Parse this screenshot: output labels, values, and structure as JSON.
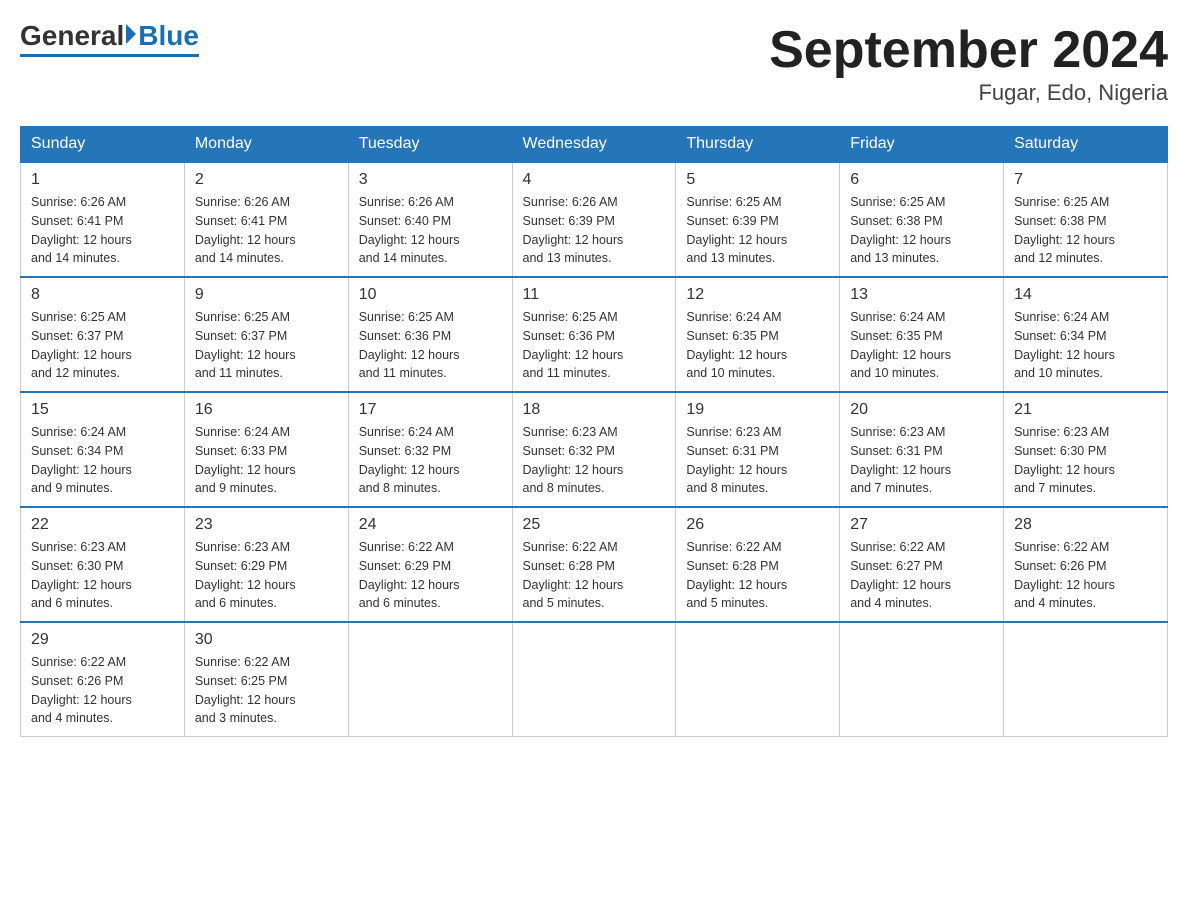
{
  "header": {
    "logo_general": "General",
    "logo_blue": "Blue",
    "month_title": "September 2024",
    "location": "Fugar, Edo, Nigeria"
  },
  "days_of_week": [
    "Sunday",
    "Monday",
    "Tuesday",
    "Wednesday",
    "Thursday",
    "Friday",
    "Saturday"
  ],
  "weeks": [
    [
      {
        "day": "1",
        "sunrise": "6:26 AM",
        "sunset": "6:41 PM",
        "daylight": "12 hours and 14 minutes."
      },
      {
        "day": "2",
        "sunrise": "6:26 AM",
        "sunset": "6:41 PM",
        "daylight": "12 hours and 14 minutes."
      },
      {
        "day": "3",
        "sunrise": "6:26 AM",
        "sunset": "6:40 PM",
        "daylight": "12 hours and 14 minutes."
      },
      {
        "day": "4",
        "sunrise": "6:26 AM",
        "sunset": "6:39 PM",
        "daylight": "12 hours and 13 minutes."
      },
      {
        "day": "5",
        "sunrise": "6:25 AM",
        "sunset": "6:39 PM",
        "daylight": "12 hours and 13 minutes."
      },
      {
        "day": "6",
        "sunrise": "6:25 AM",
        "sunset": "6:38 PM",
        "daylight": "12 hours and 13 minutes."
      },
      {
        "day": "7",
        "sunrise": "6:25 AM",
        "sunset": "6:38 PM",
        "daylight": "12 hours and 12 minutes."
      }
    ],
    [
      {
        "day": "8",
        "sunrise": "6:25 AM",
        "sunset": "6:37 PM",
        "daylight": "12 hours and 12 minutes."
      },
      {
        "day": "9",
        "sunrise": "6:25 AM",
        "sunset": "6:37 PM",
        "daylight": "12 hours and 11 minutes."
      },
      {
        "day": "10",
        "sunrise": "6:25 AM",
        "sunset": "6:36 PM",
        "daylight": "12 hours and 11 minutes."
      },
      {
        "day": "11",
        "sunrise": "6:25 AM",
        "sunset": "6:36 PM",
        "daylight": "12 hours and 11 minutes."
      },
      {
        "day": "12",
        "sunrise": "6:24 AM",
        "sunset": "6:35 PM",
        "daylight": "12 hours and 10 minutes."
      },
      {
        "day": "13",
        "sunrise": "6:24 AM",
        "sunset": "6:35 PM",
        "daylight": "12 hours and 10 minutes."
      },
      {
        "day": "14",
        "sunrise": "6:24 AM",
        "sunset": "6:34 PM",
        "daylight": "12 hours and 10 minutes."
      }
    ],
    [
      {
        "day": "15",
        "sunrise": "6:24 AM",
        "sunset": "6:34 PM",
        "daylight": "12 hours and 9 minutes."
      },
      {
        "day": "16",
        "sunrise": "6:24 AM",
        "sunset": "6:33 PM",
        "daylight": "12 hours and 9 minutes."
      },
      {
        "day": "17",
        "sunrise": "6:24 AM",
        "sunset": "6:32 PM",
        "daylight": "12 hours and 8 minutes."
      },
      {
        "day": "18",
        "sunrise": "6:23 AM",
        "sunset": "6:32 PM",
        "daylight": "12 hours and 8 minutes."
      },
      {
        "day": "19",
        "sunrise": "6:23 AM",
        "sunset": "6:31 PM",
        "daylight": "12 hours and 8 minutes."
      },
      {
        "day": "20",
        "sunrise": "6:23 AM",
        "sunset": "6:31 PM",
        "daylight": "12 hours and 7 minutes."
      },
      {
        "day": "21",
        "sunrise": "6:23 AM",
        "sunset": "6:30 PM",
        "daylight": "12 hours and 7 minutes."
      }
    ],
    [
      {
        "day": "22",
        "sunrise": "6:23 AM",
        "sunset": "6:30 PM",
        "daylight": "12 hours and 6 minutes."
      },
      {
        "day": "23",
        "sunrise": "6:23 AM",
        "sunset": "6:29 PM",
        "daylight": "12 hours and 6 minutes."
      },
      {
        "day": "24",
        "sunrise": "6:22 AM",
        "sunset": "6:29 PM",
        "daylight": "12 hours and 6 minutes."
      },
      {
        "day": "25",
        "sunrise": "6:22 AM",
        "sunset": "6:28 PM",
        "daylight": "12 hours and 5 minutes."
      },
      {
        "day": "26",
        "sunrise": "6:22 AM",
        "sunset": "6:28 PM",
        "daylight": "12 hours and 5 minutes."
      },
      {
        "day": "27",
        "sunrise": "6:22 AM",
        "sunset": "6:27 PM",
        "daylight": "12 hours and 4 minutes."
      },
      {
        "day": "28",
        "sunrise": "6:22 AM",
        "sunset": "6:26 PM",
        "daylight": "12 hours and 4 minutes."
      }
    ],
    [
      {
        "day": "29",
        "sunrise": "6:22 AM",
        "sunset": "6:26 PM",
        "daylight": "12 hours and 4 minutes."
      },
      {
        "day": "30",
        "sunrise": "6:22 AM",
        "sunset": "6:25 PM",
        "daylight": "12 hours and 3 minutes."
      },
      null,
      null,
      null,
      null,
      null
    ]
  ],
  "labels": {
    "sunrise": "Sunrise:",
    "sunset": "Sunset:",
    "daylight": "Daylight:"
  }
}
